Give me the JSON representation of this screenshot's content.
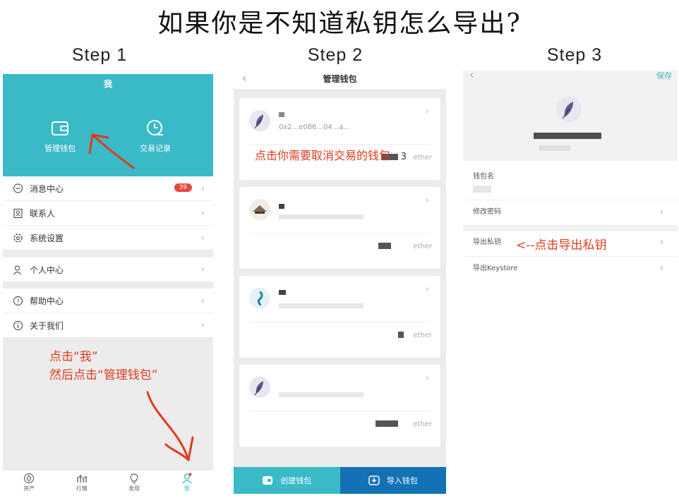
{
  "page": {
    "title": "如果你是不知道私钥怎么导出?",
    "steps": [
      "Step 1",
      "Step 2",
      "Step 3"
    ]
  },
  "panel1": {
    "title": "我",
    "actions": [
      {
        "label": "管理钱包",
        "icon": "wallet-icon"
      },
      {
        "label": "交易记录",
        "icon": "clock-icon"
      }
    ],
    "menu": [
      {
        "label": "消息中心",
        "icon": "message-icon",
        "badge": "39"
      },
      {
        "label": "联系人",
        "icon": "contacts-icon"
      },
      {
        "label": "系统设置",
        "icon": "settings-icon"
      },
      {
        "label": "个人中心",
        "icon": "user-icon"
      },
      {
        "label": "帮助中心",
        "icon": "help-icon"
      },
      {
        "label": "关于我们",
        "icon": "info-icon"
      }
    ],
    "tabs": [
      {
        "label": "资产",
        "icon": "assets-icon"
      },
      {
        "label": "行情",
        "icon": "market-icon"
      },
      {
        "label": "发现",
        "icon": "discover-icon"
      },
      {
        "label": "我",
        "icon": "profile-icon"
      }
    ],
    "note_line1": "点击“我”",
    "note_line2": "然后点击“管理钱包”"
  },
  "panel2": {
    "title": "管理钱包",
    "address_visible": "0x2...e086...04...a...",
    "balance_digit": "3",
    "unit": "ether",
    "note": "点击你需要取消交易的钱包",
    "buttons": {
      "create": "创建钱包",
      "import": "导入钱包"
    }
  },
  "panel3": {
    "save": "保存",
    "wallet_name_label": "钱包名",
    "change_password": "修改密码",
    "export_private_key": "导出私钥",
    "export_keystore": "导出Keystore",
    "note": "<--点击导出私钥"
  },
  "colors": {
    "accent": "#3ab9c6",
    "import_blue": "#1372b5",
    "annotation_red": "#e03a1e",
    "badge_red": "#e8453c"
  }
}
